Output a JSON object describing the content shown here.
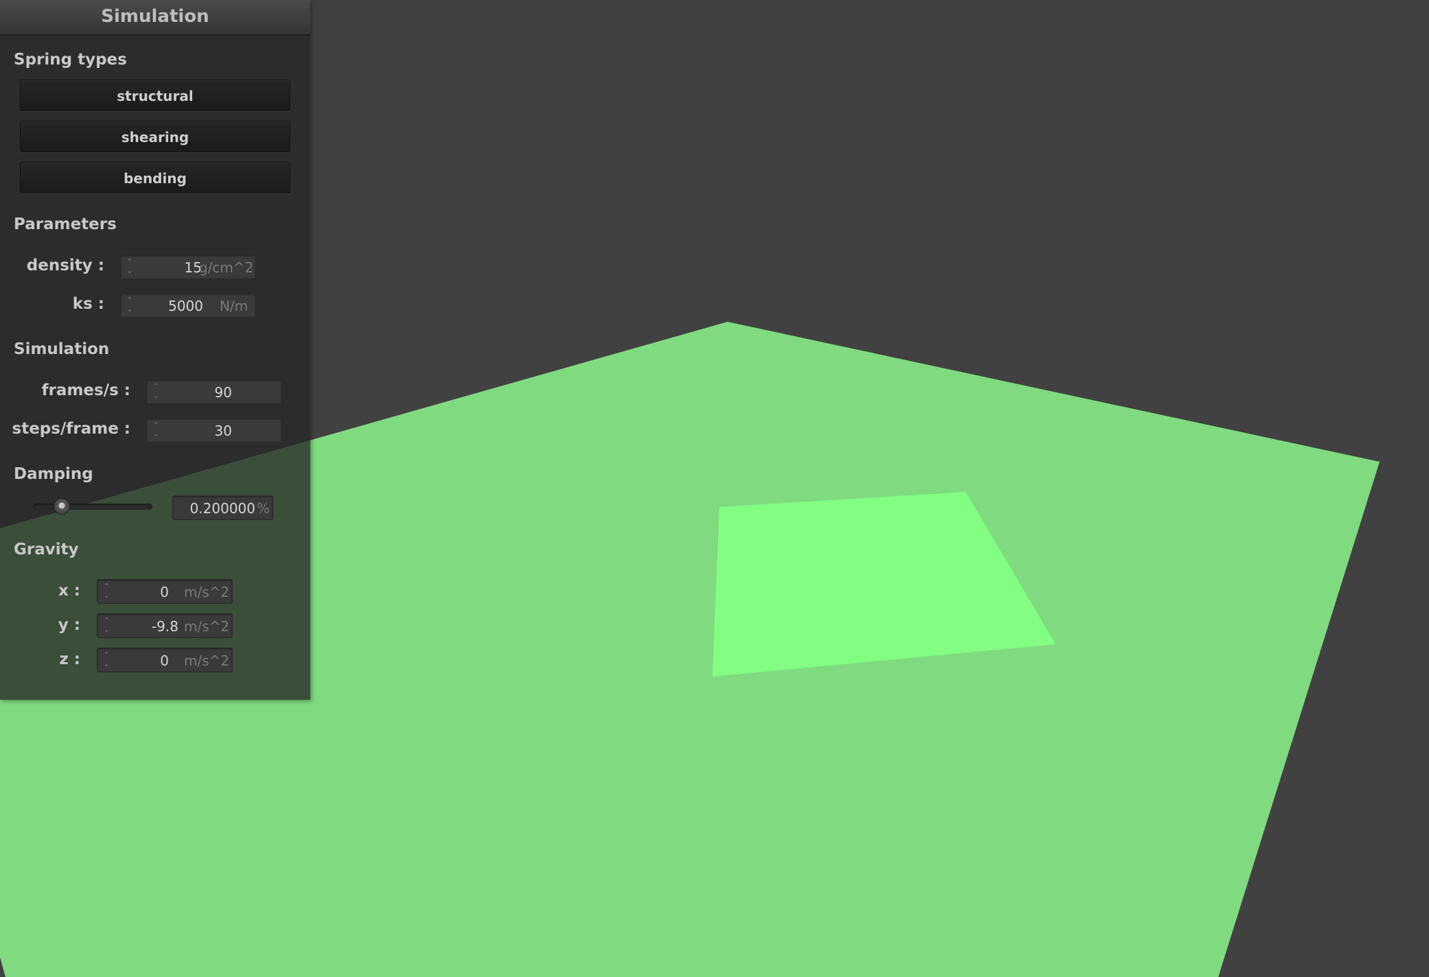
{
  "colors": {
    "background": "#414141",
    "cloth": "#80da80",
    "cloth_highlight": "#82ff82",
    "panel": "#262626"
  },
  "panel": {
    "title": "Simulation",
    "spring_types": {
      "title": "Spring types",
      "buttons": [
        "structural",
        "shearing",
        "bending"
      ]
    },
    "parameters": {
      "title": "Parameters",
      "density": {
        "label": "density :",
        "value": "15",
        "unit": "g/cm^2"
      },
      "ks": {
        "label": "ks :",
        "value": "5000",
        "unit": "N/m"
      }
    },
    "simulation": {
      "title": "Simulation",
      "fps": {
        "label": "frames/s :",
        "value": "90"
      },
      "steps": {
        "label": "steps/frame :",
        "value": "30"
      }
    },
    "damping": {
      "title": "Damping",
      "value": "0.200000",
      "unit": "%",
      "slider_fraction": 0.2
    },
    "gravity": {
      "title": "Gravity",
      "x": {
        "label": "x :",
        "value": "0",
        "unit": "m/s^2"
      },
      "y": {
        "label": "y :",
        "value": "-9.8",
        "unit": "m/s^2"
      },
      "z": {
        "label": "z :",
        "value": "0",
        "unit": "m/s^2"
      }
    }
  }
}
